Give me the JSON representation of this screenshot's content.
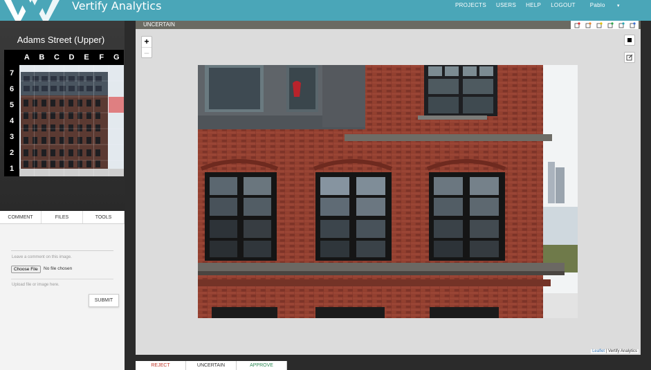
{
  "header": {
    "brand": "Vertify Analytics",
    "nav": [
      "PROJECTS",
      "USERS",
      "HELP",
      "LOGOUT"
    ],
    "user": "Pablo"
  },
  "sidebar": {
    "site_title": "Adams Street (Upper)",
    "columns": [
      "A",
      "B",
      "C",
      "D",
      "E",
      "F",
      "G"
    ],
    "rows": [
      "7",
      "6",
      "5",
      "4",
      "3",
      "2",
      "1"
    ],
    "tabs": [
      "COMMENT",
      "FILES",
      "TOOLS"
    ],
    "comment_placeholder": "Leave a comment on this image.",
    "choose_file": "Choose File",
    "no_file": "No file chosen",
    "upload_placeholder": "Upload file or image here.",
    "submit": "SUBMIT"
  },
  "main": {
    "status": "UNCERTAIN",
    "zoom_in": "+",
    "zoom_out": "–",
    "attribution_link": "Leaflet",
    "attribution_text": "| Vertify Analytics",
    "decisions": [
      "REJECT",
      "UNCERTAIN",
      "APPROVE"
    ]
  },
  "colors": {
    "header": "#4aa6b8",
    "reject": "#c0392b",
    "uncertain": "#333333",
    "approve": "#2e8b57"
  }
}
